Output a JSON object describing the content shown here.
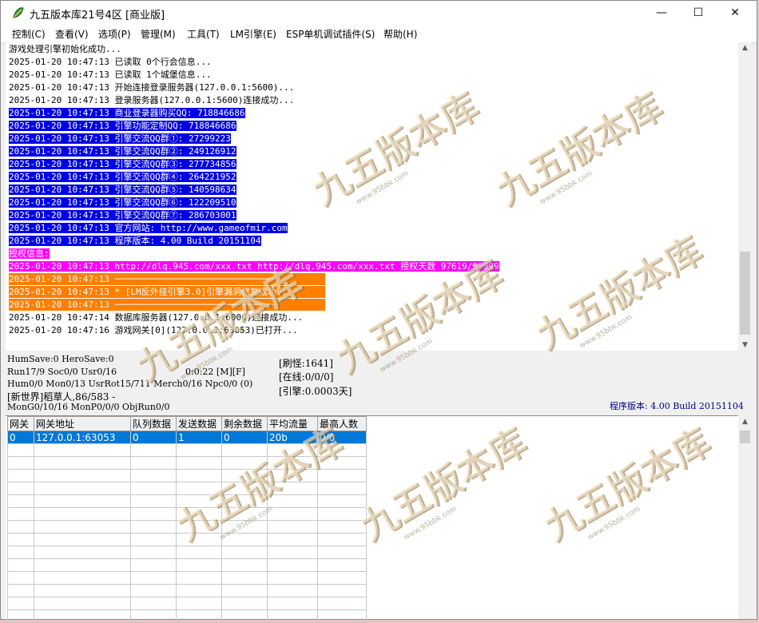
{
  "window": {
    "title": "九五版本库21号4区 [商业版]",
    "minimize_glyph": "—",
    "maximize_glyph": "☐",
    "close_glyph": "✕"
  },
  "menu": [
    {
      "label": "控制(C)"
    },
    {
      "label": "查看(V)"
    },
    {
      "label": "选项(P)"
    },
    {
      "label": "管理(M)"
    },
    {
      "label": "工具(T)"
    },
    {
      "label": "LM引擎(E)"
    },
    {
      "label": "ESP单机调试插件(S)"
    },
    {
      "label": "帮助(H)"
    }
  ],
  "log": [
    {
      "text": "游戏处理引擎初始化成功...",
      "style": "normal"
    },
    {
      "text": "2025-01-20 10:47:13 已读取 0个行会信息...",
      "style": "normal"
    },
    {
      "text": "2025-01-20 10:47:13 已读取 1个城堡信息...",
      "style": "normal"
    },
    {
      "text": "2025-01-20 10:47:13 开始连接登录服务器(127.0.0.1:5600)...",
      "style": "normal"
    },
    {
      "text": "2025-01-20 10:47:13 登录服务器(127.0.0.1:5600)连接成功...",
      "style": "normal"
    },
    {
      "text": "2025-01-20 10:47:13 商业登录器购买QQ: 718846686",
      "style": "blue"
    },
    {
      "text": "2025-01-20 10:47:13 引擎功能定制QQ: 718846686",
      "style": "blue"
    },
    {
      "text": "2025-01-20 10:47:13 引擎交流QQ群①: 27299223",
      "style": "blue"
    },
    {
      "text": "2025-01-20 10:47:13 引擎交流QQ群②: 249126912",
      "style": "blue"
    },
    {
      "text": "2025-01-20 10:47:13 引擎交流QQ群③: 277734856",
      "style": "blue"
    },
    {
      "text": "2025-01-20 10:47:13 引擎交流QQ群④: 264221952",
      "style": "blue"
    },
    {
      "text": "2025-01-20 10:47:13 引擎交流QQ群⑤: 140598634",
      "style": "blue"
    },
    {
      "text": "2025-01-20 10:47:13 引擎交流QQ群⑥: 122209510",
      "style": "blue"
    },
    {
      "text": "2025-01-20 10:47:13 引擎交流QQ群⑦: 286703001",
      "style": "blue"
    },
    {
      "text": "2025-01-20 10:47:13 官方网站: http://www.gameofmir.com",
      "style": "blue"
    },
    {
      "text": "2025-01-20 10:47:13 程序版本: 4.00 Build 20151104",
      "style": "blue"
    },
    {
      "text": "授权信息:",
      "style": "magenta"
    },
    {
      "text": "2025-01-20 10:47:13 http://dlq.945.com/xxx.txt http://dlq.945.com/xxx.txt 授权天数 97619/99999",
      "style": "magenta"
    },
    {
      "text": "2025-01-20 10:47:13 ──────────────────────────────",
      "style": "orange"
    },
    {
      "text": "2025-01-20 10:47:13 * [LM反外挂引擎3.0]引擎漏洞修复成功...",
      "style": "orange"
    },
    {
      "text": "2025-01-20 10:47:13 ──────────────────────────────",
      "style": "orange"
    },
    {
      "text": "2025-01-20 10:47:14 数据库服务器(127.0.0.1:6000)连接成功...",
      "style": "normal"
    },
    {
      "text": "2025-01-20 10:47:16 游戏网关[0](127.0.0.1:63053)已打开...",
      "style": "normal"
    }
  ],
  "status": {
    "line1": "HumSave:0 HeroSave:0",
    "line2": "Run17/9 Soc0/0 Usr0/16",
    "timer": "0:0:22 [M][F]",
    "line3": "Hum0/0 Mon0/13 UsrRot15/711 Merch0/16 Npc0/0 (0)",
    "line4": "[新世界]稻草人,86/583 -",
    "line5": "MonG0/10/16 MonP0/0/0 ObjRun0/0",
    "refresh": "[刷怪:1641]",
    "online": "[在线:0/0/0]",
    "engine": "[引擎:0.0003天]",
    "version": "程序版本: 4.00 Build 20151104"
  },
  "gateway_table": {
    "columns": [
      "网关",
      "网关地址",
      "队列数据",
      "发送数据",
      "剩余数据",
      "平均流量",
      "最高人数"
    ],
    "rows": [
      [
        "0",
        "127.0.0.1:63053",
        "0",
        "1",
        "0",
        "20b",
        "0/0"
      ]
    ]
  },
  "watermark": {
    "text": "九五版本库",
    "url": "www.95bbk.com"
  },
  "colors": {
    "log_blue": "#0000e6",
    "log_magenta": "#ff00ff",
    "log_orange": "#ff7f00",
    "selection": "#0078d7",
    "version_text": "#000080"
  }
}
